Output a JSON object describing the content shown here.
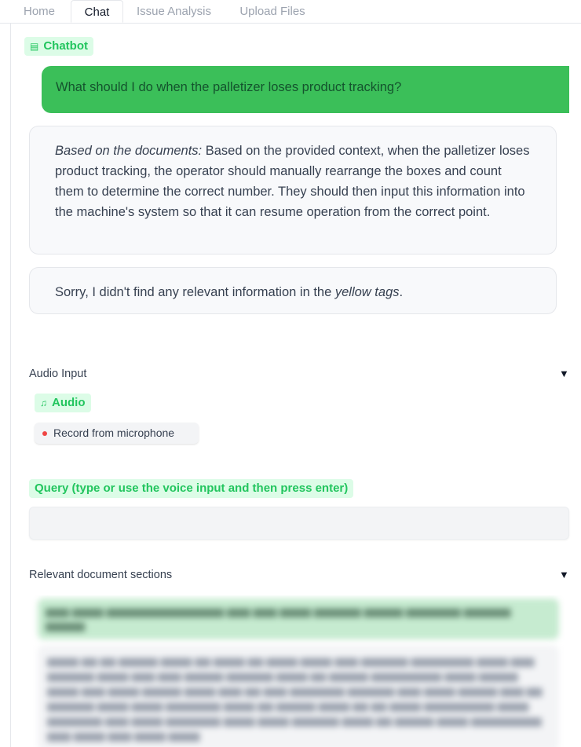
{
  "tabs": [
    {
      "label": "Home"
    },
    {
      "label": "Chat"
    },
    {
      "label": "Issue Analysis"
    },
    {
      "label": "Upload Files"
    }
  ],
  "chatbot": {
    "label": "Chatbot",
    "icon": "chat-icon",
    "messages": {
      "user": "What should I do when the palletizer loses product tracking?",
      "bot1_prefix": "Based on the documents:",
      "bot1_text": " Based on the provided context, when the palletizer loses product tracking, the operator should manually rearrange the boxes and count them to determine the correct number. They should then input this information into the machine's system so that it can resume operation from the correct point.",
      "bot2_text": "Sorry, I didn't find any relevant information in the ",
      "bot2_em": "yellow tags",
      "bot2_end": "."
    }
  },
  "audio_input": {
    "title": "Audio Input",
    "collapse_icon": "triangle-down-icon",
    "audio_label": "Audio",
    "audio_icon": "music-note-icon",
    "record_label": "Record from microphone"
  },
  "query": {
    "label": "Query (type or use the voice input and then press enter)",
    "value": ""
  },
  "relevant": {
    "title": "Relevant document sections",
    "collapse_icon": "triangle-down-icon"
  },
  "colors": {
    "accent": "#22c55e",
    "user_bubble": "#3bbf59",
    "chip_bg": "#dcfce7",
    "record_dot": "#ef4444"
  }
}
